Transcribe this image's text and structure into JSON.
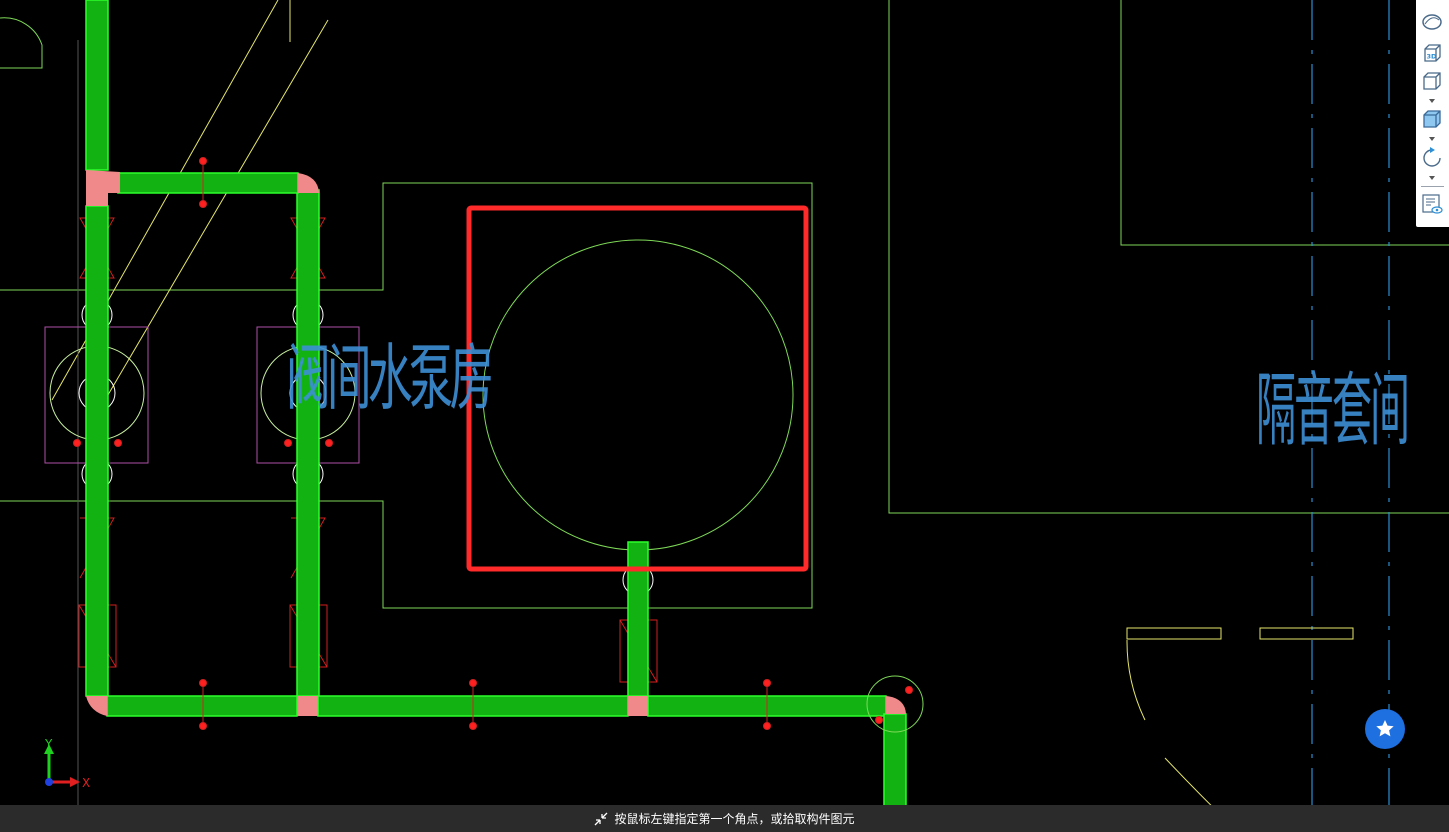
{
  "drawing": {
    "room_label_pump": "阀间水泵房",
    "room_label_vestibule": "隔音套间",
    "axis_y_label": "Y",
    "axis_x_label": "X"
  },
  "toolbar": {
    "items": [
      {
        "name": "view-orbit",
        "icon": "ellipse-icon"
      },
      {
        "name": "view-3d",
        "icon": "cube-3d-icon",
        "label": "3D"
      },
      {
        "name": "view-wire",
        "icon": "wire-cube-icon"
      },
      {
        "name": "view-shaded",
        "icon": "shaded-cube-icon"
      },
      {
        "name": "rotate",
        "icon": "rotate-icon"
      },
      {
        "name": "display-settings",
        "icon": "list-eye-icon"
      }
    ]
  },
  "status": {
    "message": "按鼠标左键指定第一个角点，或拾取构件图元"
  },
  "colors": {
    "background": "#000000",
    "pipe": "#13c613",
    "fitting": "#f08a8a",
    "selection": "#ff2a2a",
    "wall": "#7ed957",
    "text": "#3d8fd6",
    "guide": "#e6e66a"
  }
}
